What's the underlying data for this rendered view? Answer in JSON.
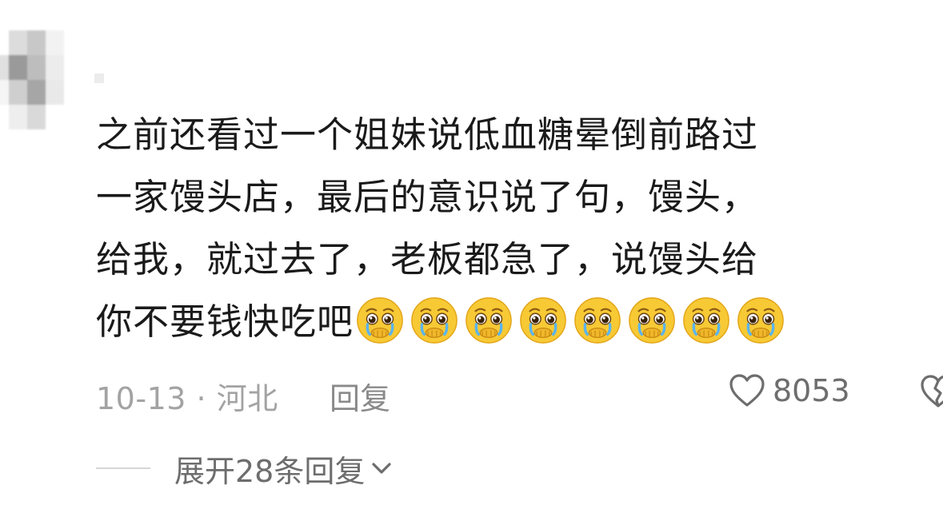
{
  "comment": {
    "line1": "之前还看过一个姐妹说低血糖晕倒前路过",
    "line2": "一家馒头店，最后的意识说了句，馒头，",
    "line3": "给我，就过去了，老板都急了，说馒头给",
    "line4": "你不要钱快吃吧",
    "emoji_name": "pleading-crying-face",
    "emoji_count": 8
  },
  "meta": {
    "date": "10-13",
    "separator": "·",
    "location": "河北",
    "reply_label": "回复",
    "like_count": "8053"
  },
  "expand": {
    "label": "展开28条回复"
  },
  "colors": {
    "text": "#1a1a1a",
    "meta": "#a3a3a3",
    "secondary": "#6d6d6d",
    "emoji_face": "#f7c935"
  }
}
